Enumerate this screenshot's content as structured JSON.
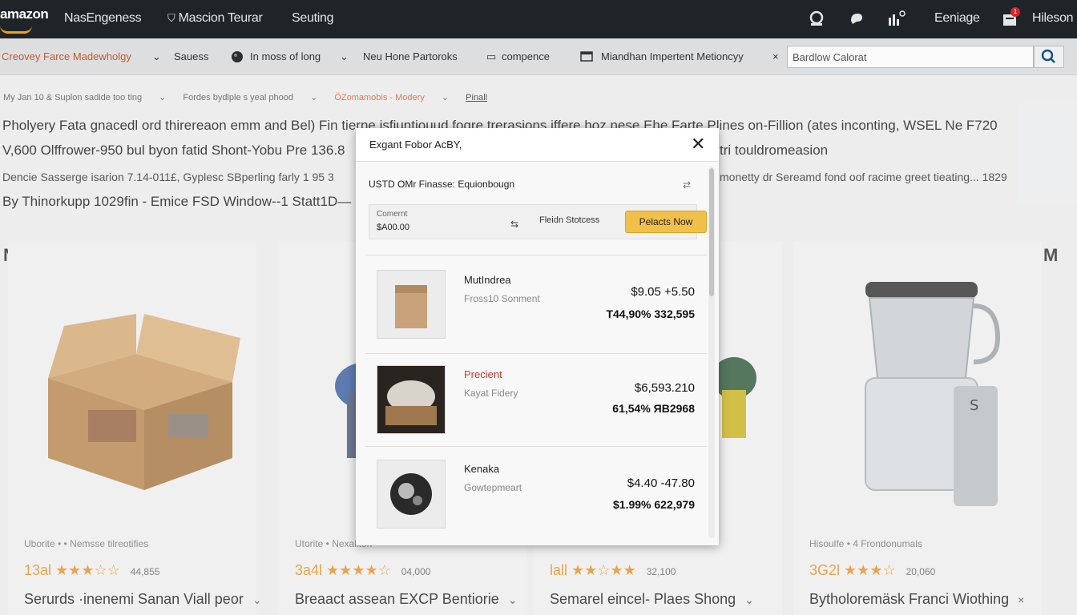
{
  "topbar": {
    "logo": "amazon",
    "nav": [
      "NasEngeness",
      "Mascion Teurar",
      "Seuting"
    ],
    "nav_icon_2": "filter-icon",
    "right_label_1": "Eeniage",
    "right_label_2": "Hileson",
    "notification_count": "1"
  },
  "subbar": {
    "items": [
      "Creovey Farce Madewholgy",
      "Sauess",
      "In moss of long",
      "Neu Hone Partoroks",
      "compence",
      "Miandhan Impertent Metioncyy"
    ],
    "search_value": "Bardlow Calorat"
  },
  "breadcrumb": [
    "My Jan 10 & Suplon sadide too ting",
    "Fordes bydlple s yeal phood",
    "ÖZomamobis - Modery",
    "Pinall"
  ],
  "headline": {
    "line1": "Pholyery Fata gnacedl ord thirereaon emm and Bel) Fin tierne isfiuntiouud fogre trerasions iffere hoz nese Ehe Farte Plines on-Fillion (ates inconting, WSEL Ne F720",
    "line2": "V,600 Olffrower-950 bul byon fatid Shont-Yobu Pre 136.8",
    "line2_right": "tri touldromeasion",
    "line3": "Dencie Sasserge isarion 7.14-011£, Gyplesc SBperling farly 1 95 3",
    "line3_right": "monetty dr Sereamd fond oof racime greet tieating... 1829",
    "line4": "By Thinorkupp 1029fin - Emice FSD Window--1 Statt1D—"
  },
  "cards": [
    {
      "meta": "Uborite • • Nemsse tilreotifies",
      "rating_prefix": "13al",
      "stars": "★★★☆☆",
      "count": "44,855",
      "title": "Serurds ·inenemi Sanan Viall peor",
      "chevron": "v"
    },
    {
      "meta": "Utorite • Nexaliton",
      "rating_prefix": "3a4l",
      "stars": "★★★★☆",
      "count": "04,000",
      "title": "Breaact assean EXCP Bentiorie",
      "chevron": "v"
    },
    {
      "meta": "",
      "rating_prefix": "lall",
      "stars": "★★☆★★",
      "count": "32,100",
      "title": "Semarel eincel- Plaes Shong",
      "chevron": "v"
    },
    {
      "meta": "Hisoulfe • 4 Frondonumals",
      "rating_prefix": "3G2l",
      "stars": "★★★☆",
      "count": "20,060",
      "title": "Bytholoremäsk Franci Wiothing",
      "chevron": "x"
    }
  ],
  "side_icons": {
    "left": "N",
    "right": "M"
  },
  "modal": {
    "title": "Exgant Fobor AcBY,",
    "close": "✕",
    "label": "USTD OMr Finasse: Equionbougn",
    "currency_label": "Comernt",
    "currency_value": "$A00.00",
    "currency_option": "Fleidn Stotcess",
    "button": "Pelacts Now",
    "items": [
      {
        "name": "MutIndrea",
        "sub": "Fross10 Sonment",
        "price1": "$9.05 +5.50",
        "price2": "T44,90% 332,595",
        "red": false
      },
      {
        "name": "Precient",
        "sub": "Kayat Fidery",
        "price1": "$6,593.210",
        "price2": "61,54% ЯB2968",
        "red": true
      },
      {
        "name": "Kenaka",
        "sub": "Gowtepmeart",
        "price1": "$4.40 -47.80",
        "price2": "$1.99% 622,979",
        "red": false
      }
    ]
  },
  "colors": {
    "topbar": "#1f2428",
    "accent_orange": "#f0a21a",
    "button_yellow": "#f0c04a",
    "star": "#e39225",
    "red_label": "#d0352b"
  }
}
